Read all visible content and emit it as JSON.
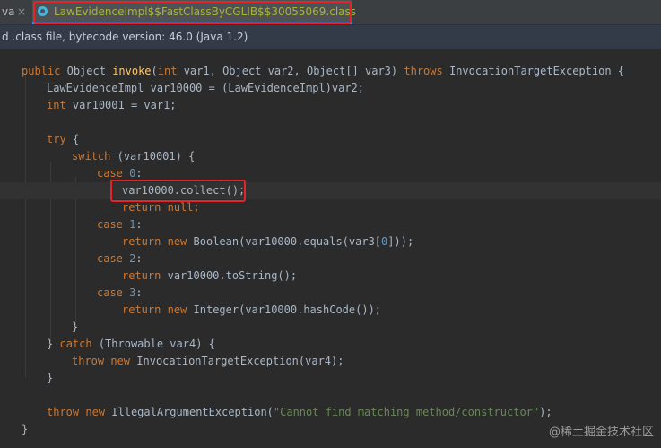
{
  "tabs": {
    "previous_label": "va",
    "active_label": "LawEvidenceImpl$$FastClassByCGLIB$$30055069.class"
  },
  "info_bar": {
    "text": "d .class file, bytecode version: 46.0 (Java 1.2)"
  },
  "code": {
    "public": "public",
    "object_type": "Object",
    "method_name": "invoke",
    "int": "int",
    "p1": "var1,",
    "p2": "Object var2, Object[] var3)",
    "throws": "throws",
    "exception": "InvocationTargetException {",
    "l2": "LawEvidenceImpl var10000 = (LawEvidenceImpl)var2;",
    "l3_int": "int",
    "l3_rest": "var10001 = var1;",
    "try": "try",
    "brace_open": "{",
    "switch": "switch",
    "switch_rest": "(var10001) {",
    "case": "case",
    "n0": "0",
    "n1": "1",
    "n2": "2",
    "n3": "3",
    "colon": ":",
    "collect": "var10000.collect();",
    "return": "return",
    "null": "null",
    "semicolon": ";",
    "new": "new",
    "boolean_call_a": "Boolean(var10000.equals(var3[",
    "boolean_call_b": "]));",
    "tostring": "var10000.toString();",
    "integer_call": "Integer(var10000.hashCode());",
    "brace_close": "}",
    "catch_close": "}",
    "catch": "catch",
    "catch_rest": "(Throwable var4) {",
    "throw": "throw",
    "ite_call": "InvocationTargetException(var4);",
    "iae": "IllegalArgumentException(",
    "iae_msg": "\"Cannot find matching method/constructor\"",
    "iae_end": ");"
  },
  "watermark": "@稀土掘金技术社区",
  "colors": {
    "highlight_box": "#e3252b",
    "keyword": "#cc7832",
    "method": "#ffc66d",
    "number": "#6897bb",
    "string": "#6a8759",
    "active_tab_text": "#a9b33b"
  }
}
